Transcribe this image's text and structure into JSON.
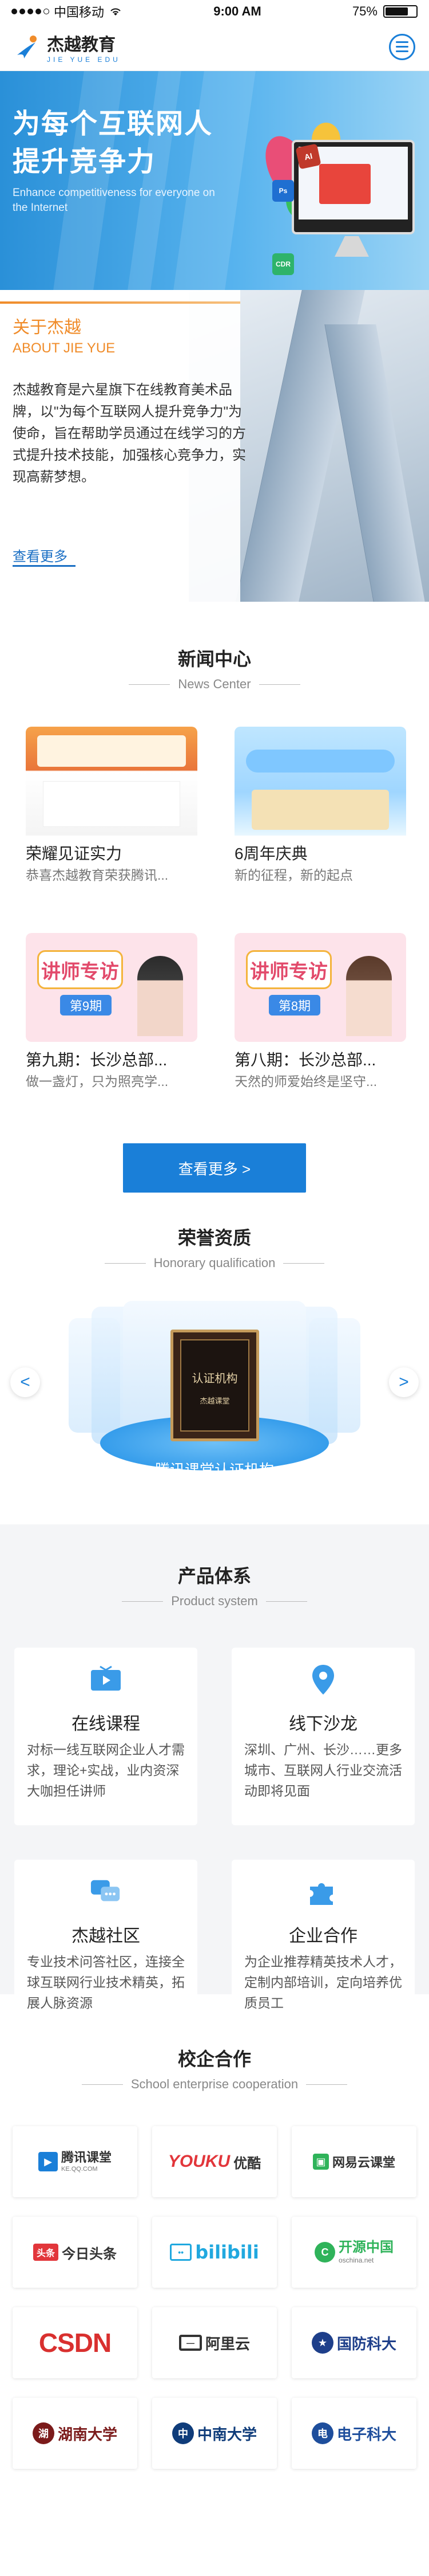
{
  "status_bar": {
    "carrier": "中国移动",
    "time": "9:00 AM",
    "battery": "75%",
    "battery_level": 0.75
  },
  "header": {
    "logo_cn": "杰越教育",
    "logo_pinyin": "JIE YUE EDU"
  },
  "banner": {
    "headline_line1": "为每个互联网人",
    "headline_line2": "提升竞争力",
    "subline_en": "Enhance competitiveness for everyone on the Internet",
    "badge_ai": "AI",
    "badge_cdr": "CDR",
    "badge_ps": "Ps"
  },
  "about": {
    "title_cn": "关于杰越",
    "title_en": "ABOUT JIE YUE",
    "description": "杰越教育是六星旗下在线教育美术品牌，以\"为每个互联网人提升竞争力\"为使命，旨在帮助学员通过在线学习的方式提升技术技能，加强核心竞争力，实现高薪梦想。",
    "more_label": "查看更多"
  },
  "news": {
    "title_cn": "新闻中心",
    "title_en": "News Center",
    "items": [
      {
        "title": "荣耀见证实力",
        "summary": "恭喜杰越教育荣获腾讯..."
      },
      {
        "title": "6周年庆典",
        "summary": "新的征程，新的起点"
      },
      {
        "title": "第九期：长沙总部...",
        "summary": "做一盏灯，只为照亮学...",
        "banner_text": "讲师专访",
        "issue": "第9期"
      },
      {
        "title": "第八期：长沙总部...",
        "summary": "天然的师爱始终是坚守...",
        "banner_text": "讲师专访",
        "issue": "第8期"
      }
    ],
    "more_button": "查看更多 >"
  },
  "honor": {
    "title_cn": "荣誉资质",
    "title_en": "Honorary qualification",
    "plaque_title": "认证机构",
    "plaque_sub": "杰越课堂",
    "caption": "腾讯课堂认证机构",
    "prev_arrow": "<",
    "next_arrow": ">"
  },
  "products": {
    "title_cn": "产品体系",
    "title_en": "Product system",
    "items": [
      {
        "title": "在线课程",
        "desc": "对标一线互联网企业人才需求，理论+实战，业内资深大咖担任讲师",
        "icon": "video-icon"
      },
      {
        "title": "线下沙龙",
        "desc": "深圳、广州、长沙……更多城市、互联网人行业交流活动即将见面",
        "icon": "location-pin-icon"
      },
      {
        "title": "杰越社区",
        "desc": "专业技术问答社区，连接全球互联网行业技术精英，拓展人脉资源",
        "icon": "chat-icon"
      },
      {
        "title": "企业合作",
        "desc": "为企业推荐精英技术人才，定制内部培训，定向培养优质员工",
        "icon": "puzzle-icon"
      }
    ],
    "accent": "#3a9be8"
  },
  "partners": {
    "title_cn": "校企合作",
    "title_en": "School enterprise cooperation",
    "items": [
      {
        "name": "腾讯课堂",
        "sub": "KE.QQ.COM"
      },
      {
        "name": "优酷",
        "sub": "YOUKU"
      },
      {
        "name": "网易云课堂",
        "sub": ""
      },
      {
        "name": "今日头条",
        "sub": "头条"
      },
      {
        "name": "bilibili",
        "sub": ""
      },
      {
        "name": "开源中国",
        "sub": "oschina.net"
      },
      {
        "name": "CSDN",
        "sub": ""
      },
      {
        "name": "阿里云",
        "sub": ""
      },
      {
        "name": "国防科大",
        "sub": ""
      },
      {
        "name": "湖南大学",
        "sub": ""
      },
      {
        "name": "中南大学",
        "sub": ""
      },
      {
        "name": "电子科大",
        "sub": ""
      }
    ]
  },
  "colors": {
    "brand_blue": "#1a7fd8",
    "orange": "#f08c2a"
  }
}
